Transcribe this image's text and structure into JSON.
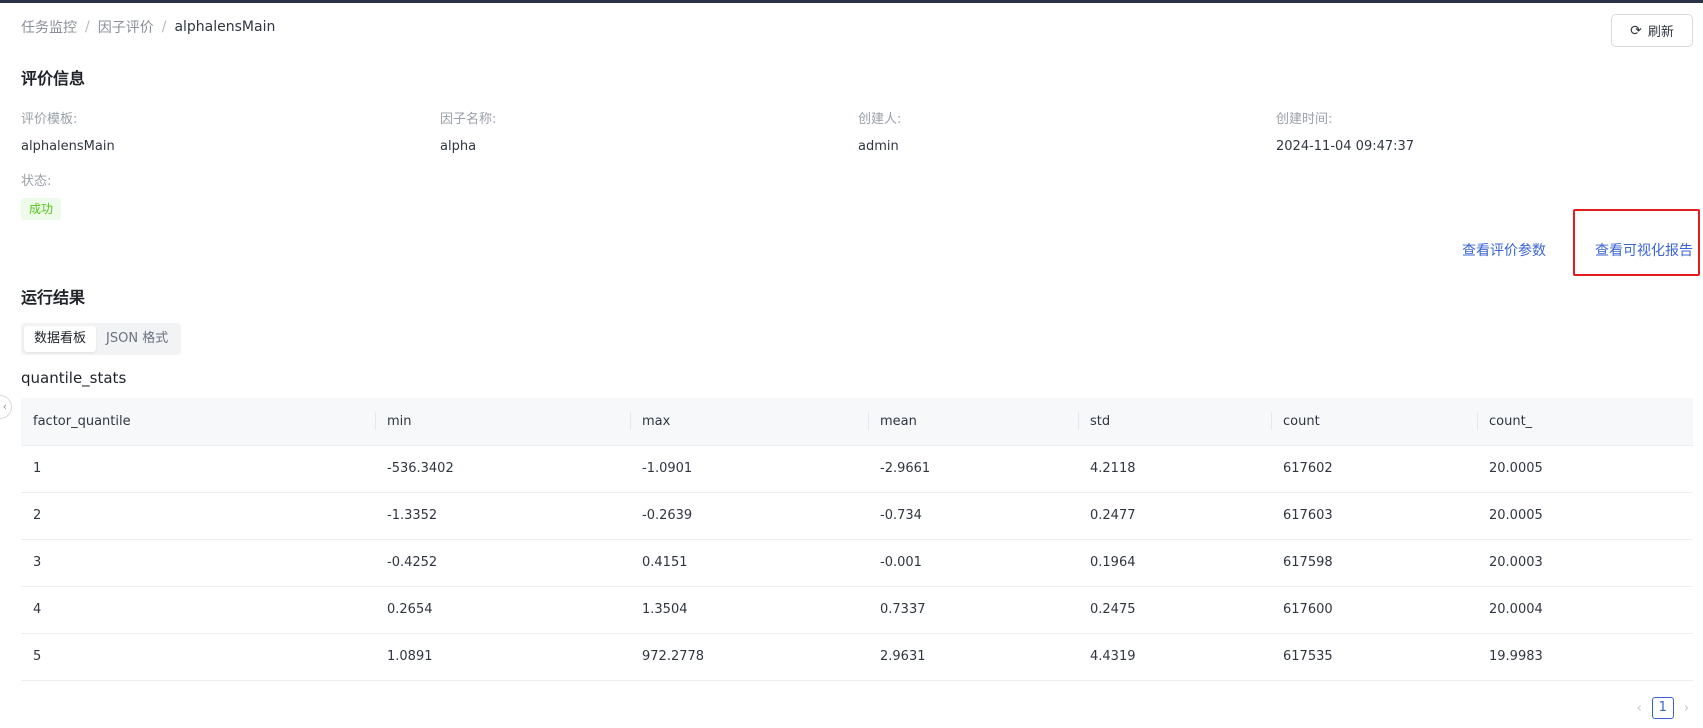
{
  "breadcrumb": [
    "任务监控",
    "因子评价",
    "alphalensMain"
  ],
  "toolbar": {
    "refresh_label": "刷新",
    "refresh_icon": "refresh-icon"
  },
  "eval_info": {
    "title": "评价信息",
    "template_label": "评价模板:",
    "template_value": "alphalensMain",
    "factor_label": "因子名称:",
    "factor_value": "alpha",
    "creator_label": "创建人:",
    "creator_value": "admin",
    "created_label": "创建时间:",
    "created_value": "2024-11-04 09:47:37",
    "status_label": "状态:",
    "status_value": "成功"
  },
  "actions": {
    "view_params": "查看评价参数",
    "view_report": "查看可视化报告"
  },
  "results": {
    "title": "运行结果",
    "tabs": [
      "数据看板",
      "JSON 格式"
    ],
    "active_tab": "数据看板",
    "table_title": "quantile_stats",
    "columns": [
      "factor_quantile",
      "min",
      "max",
      "mean",
      "std",
      "count",
      "count_"
    ],
    "rows": [
      [
        "1",
        "-536.3402",
        "-1.0901",
        "-2.9661",
        "4.2118",
        "617602",
        "20.0005"
      ],
      [
        "2",
        "-1.3352",
        "-0.2639",
        "-0.734",
        "0.2477",
        "617603",
        "20.0005"
      ],
      [
        "3",
        "-0.4252",
        "0.4151",
        "-0.001",
        "0.1964",
        "617598",
        "20.0003"
      ],
      [
        "4",
        "0.2654",
        "1.3504",
        "0.7337",
        "0.2475",
        "617600",
        "20.0004"
      ],
      [
        "5",
        "1.0891",
        "972.2778",
        "2.9631",
        "4.4319",
        "617535",
        "19.9983"
      ]
    ]
  },
  "pagination": {
    "current_page": "1",
    "prev_icon": "chevron-left-icon",
    "next_icon": "chevron-right-icon"
  },
  "colors": {
    "link": "#3b63d6",
    "success": "#52c41a",
    "highlight": "#e11d1d"
  }
}
